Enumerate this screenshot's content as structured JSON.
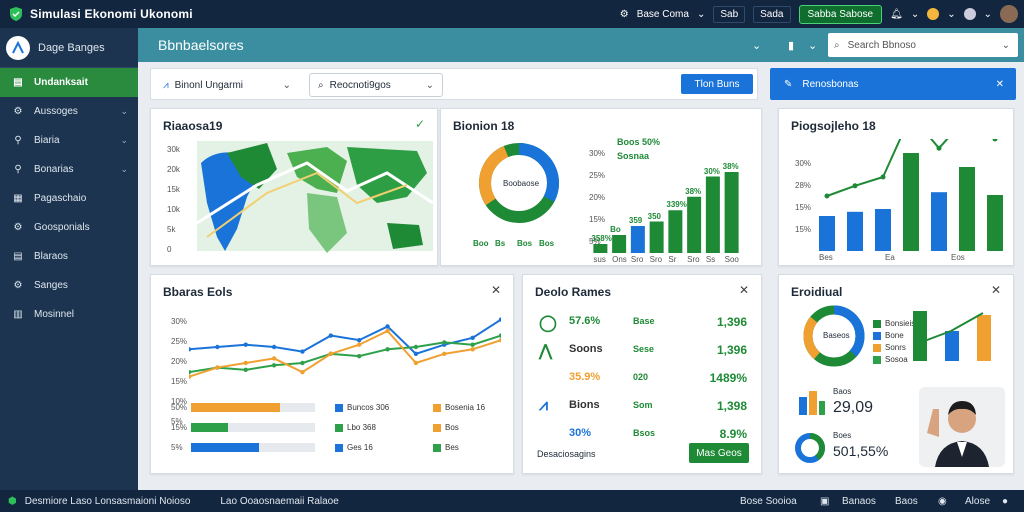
{
  "topbar": {
    "title": "Simulasi Ekonomi Ukonomi",
    "items": [
      "Base Coma",
      "Sab",
      "Sada",
      "Sabba Sabose"
    ]
  },
  "sidebar": {
    "header": "Dage Banges",
    "items": [
      {
        "label": "Undanksait",
        "active": true
      },
      {
        "label": "Aussoges",
        "chev": true
      },
      {
        "label": "Biaria",
        "chev": true
      },
      {
        "label": "Bonarias",
        "chev": true
      },
      {
        "label": "Pagaschaio"
      },
      {
        "label": "Goosponials"
      },
      {
        "label": "Blaraos"
      },
      {
        "label": "Sanges"
      },
      {
        "label": "Mosinnel"
      }
    ]
  },
  "header": {
    "title": "Bbnbaelsores",
    "search_placeholder": "Search Bbnoso"
  },
  "filters": {
    "select1": "Binonl Ungarmi",
    "select2": "Reocnoti9gos",
    "btn1": "Tlon Buns"
  },
  "banner": {
    "label": "Renosbonas"
  },
  "map_card": {
    "title": "Riaaosa19",
    "yticks": [
      "30k",
      "20k",
      "15k",
      "10k",
      "5k",
      "0"
    ]
  },
  "donut_card": {
    "title": "Bionion 18",
    "donut_label": "Boobaose",
    "green_label1": "Boos 50%",
    "green_label2": "Sosnaa",
    "yticks": [
      "30%",
      "25%",
      "20%",
      "15%",
      "5%"
    ],
    "xlabels": [
      "Boo",
      "Bs",
      "Bos",
      "Bos"
    ],
    "bar_labels": [
      "358%",
      "Bo",
      "359",
      "350",
      "339%",
      "38%",
      "30%",
      "38%"
    ],
    "bar_xlabels": [
      "sus",
      "Ons",
      "Sro",
      "Sro",
      "Sr",
      "Sro",
      "Ss",
      "Soo"
    ]
  },
  "prog_card": {
    "title": "Piogsojleho 18",
    "yticks": [
      "30%",
      "28%",
      "15%",
      "15%"
    ],
    "xlabels": [
      "Bes",
      "Ea",
      "Eos"
    ]
  },
  "line_card": {
    "title": "Bbaras Eols",
    "yticks": [
      "30%",
      "25%",
      "20%",
      "15%",
      "10%",
      "5%"
    ],
    "legend": [
      {
        "label": "Buncos 306",
        "color": "#1a73d9"
      },
      {
        "label": "Bosenia 16",
        "color": "#f0a030"
      },
      {
        "label": "Lbo 368",
        "color": "#2fa04a"
      },
      {
        "label": "Bos",
        "color": "#f0a030"
      },
      {
        "label": "Ges 16",
        "color": "#1a73d9"
      },
      {
        "label": "Bes",
        "color": "#2fa04a"
      }
    ],
    "progress": [
      {
        "label": "50%",
        "color": "#f0a030",
        "frac": 0.72
      },
      {
        "label": "15%",
        "color": "#2fa04a",
        "frac": 0.3
      },
      {
        "label": "5%",
        "color": "#1a73d9",
        "frac": 0.55
      }
    ]
  },
  "stats_card": {
    "title": "Deolo Rames",
    "rows": [
      {
        "pct": "57.6%",
        "mid": "Base",
        "val": "1,396"
      },
      {
        "pct": "Soons",
        "mid": "Sese",
        "val": "1,396"
      },
      {
        "pct": "35.9%",
        "mid": "020",
        "val": "1489%"
      },
      {
        "pct": "Bions",
        "mid": "Som",
        "val": "1,398"
      },
      {
        "pct": "30%",
        "mid": "Bsos",
        "val": "8.9%"
      }
    ],
    "footer_label": "Desaciosagins",
    "button": "Mas Geos"
  },
  "right_card": {
    "title": "Eroidiual",
    "legend": [
      "Bonsieis",
      "Bone",
      "Sonrs",
      "Sosoa"
    ],
    "donut_label": "Baseos",
    "stat1_label": "Baos",
    "stat1_value": "29,09",
    "stat2_label": "Boes",
    "stat2_value": "501,55%"
  },
  "footer": {
    "left": "Desmiore Laso Lonsasmaioni Noioso",
    "mid": "Lao Ooaosnaemaii Ralaoe",
    "right": [
      "Bose Sooioa",
      "Banaos",
      "Baos",
      "Alose"
    ]
  },
  "chart_data": [
    {
      "type": "bar",
      "title": "Bionion 18",
      "categories": [
        "1",
        "2",
        "3",
        "4",
        "5",
        "6",
        "7",
        "8"
      ],
      "values": [
        8,
        16,
        24,
        28,
        38,
        50,
        68,
        72
      ],
      "colors": [
        "#1e8a36",
        "#1e8a36",
        "#1a73d9",
        "#1e8a36",
        "#1e8a36",
        "#1e8a36",
        "#1e8a36",
        "#1e8a36"
      ],
      "ylim": [
        0,
        80
      ]
    },
    {
      "type": "line",
      "title": "Bbaras Eols",
      "series": [
        {
          "color": "#1a73d9",
          "values": [
            20,
            21,
            22,
            21,
            19,
            26,
            24,
            30,
            18,
            22,
            25,
            33
          ]
        },
        {
          "color": "#2fa04a",
          "values": [
            10,
            12,
            11,
            13,
            14,
            18,
            17,
            20,
            21,
            23,
            22,
            26
          ]
        },
        {
          "color": "#f0a030",
          "values": [
            8,
            12,
            14,
            16,
            10,
            18,
            22,
            28,
            14,
            18,
            20,
            24
          ]
        }
      ],
      "ylim": [
        0,
        35
      ]
    },
    {
      "type": "bar",
      "title": "Piogsojleho 18",
      "categories": [
        "1",
        "2",
        "3",
        "4",
        "5",
        "6",
        "7"
      ],
      "values": [
        25,
        28,
        30,
        70,
        42,
        60,
        40
      ],
      "colors": [
        "#1a73d9",
        "#1a73d9",
        "#1a73d9",
        "#1e8a36",
        "#1a73d9",
        "#1e8a36",
        "#1e8a36"
      ],
      "ylim": [
        0,
        80
      ]
    }
  ]
}
